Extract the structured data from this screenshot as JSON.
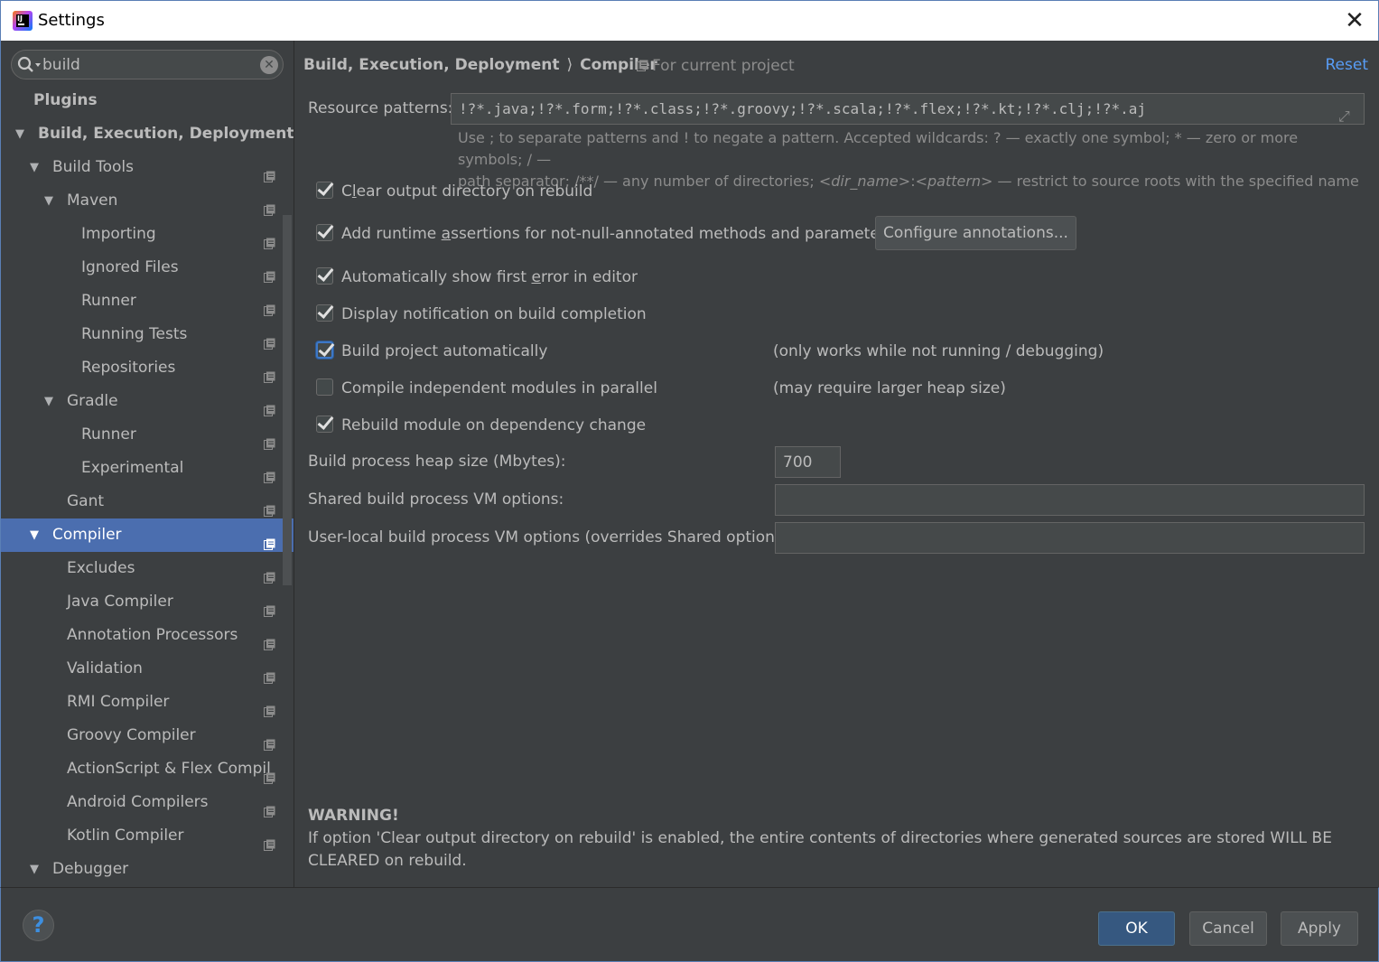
{
  "window": {
    "title": "Settings"
  },
  "search": {
    "value": "build"
  },
  "tree": [
    {
      "label": "Plugins",
      "level": 0,
      "arrow": "",
      "bold": true,
      "icon": false
    },
    {
      "label": "Build, Execution, Deployment",
      "level": 0,
      "arrow": "▼",
      "bold": true,
      "icon": false
    },
    {
      "label": "Build Tools",
      "level": 1,
      "arrow": "▼",
      "icon": true
    },
    {
      "label": "Maven",
      "level": 2,
      "arrow": "▼",
      "icon": true
    },
    {
      "label": "Importing",
      "level": 3,
      "arrow": "",
      "icon": true
    },
    {
      "label": "Ignored Files",
      "level": 3,
      "arrow": "",
      "icon": true
    },
    {
      "label": "Runner",
      "level": 3,
      "arrow": "",
      "icon": true
    },
    {
      "label": "Running Tests",
      "level": 3,
      "arrow": "",
      "icon": true
    },
    {
      "label": "Repositories",
      "level": 3,
      "arrow": "",
      "icon": true
    },
    {
      "label": "Gradle",
      "level": 2,
      "arrow": "▼",
      "icon": true
    },
    {
      "label": "Runner",
      "level": 3,
      "arrow": "",
      "icon": true
    },
    {
      "label": "Experimental",
      "level": 3,
      "arrow": "",
      "icon": true
    },
    {
      "label": "Gant",
      "level": 2,
      "arrow": "",
      "icon": true
    },
    {
      "label": "Compiler",
      "level": 1,
      "arrow": "▼",
      "icon": true,
      "selected": true
    },
    {
      "label": "Excludes",
      "level": 2,
      "arrow": "",
      "icon": true
    },
    {
      "label": "Java Compiler",
      "level": 2,
      "arrow": "",
      "icon": true
    },
    {
      "label": "Annotation Processors",
      "level": 2,
      "arrow": "",
      "icon": true
    },
    {
      "label": "Validation",
      "level": 2,
      "arrow": "",
      "icon": true
    },
    {
      "label": "RMI Compiler",
      "level": 2,
      "arrow": "",
      "icon": true
    },
    {
      "label": "Groovy Compiler",
      "level": 2,
      "arrow": "",
      "icon": true
    },
    {
      "label": "ActionScript & Flex Compil",
      "level": 2,
      "arrow": "",
      "icon": true
    },
    {
      "label": "Android Compilers",
      "level": 2,
      "arrow": "",
      "icon": true
    },
    {
      "label": "Kotlin Compiler",
      "level": 2,
      "arrow": "",
      "icon": true
    },
    {
      "label": "Debugger",
      "level": 1,
      "arrow": "▼",
      "icon": false
    }
  ],
  "header": {
    "crumb1": "Build, Execution, Deployment",
    "crumb2": "Compiler",
    "separator": "⟩",
    "scope": "For current project",
    "reset": "Reset"
  },
  "resource": {
    "label": "Resource patterns:",
    "value": "!?*.java;!?*.form;!?*.class;!?*.groovy;!?*.scala;!?*.flex;!?*.kt;!?*.clj;!?*.aj",
    "hint_line1": "Use ; to separate patterns and ! to negate a pattern. Accepted wildcards: ? — exactly one symbol; * — zero or more symbols; / —",
    "hint_line2a": "path separator; /**/ — any number of directories; ",
    "hint_dir": "<dir_name>",
    "hint_colon": ":",
    "hint_pattern": "<pattern>",
    "hint_line2b": " — restrict to source roots with the specified name"
  },
  "options": {
    "clear_output": {
      "pre": "C",
      "u": "l",
      "post": "ear output directory on rebuild"
    },
    "add_assertions": {
      "pre": "Add runtime ",
      "u": "a",
      "post": "ssertions for not-null-annotated methods and parameters"
    },
    "configure_annotations": "Configure annotations...",
    "show_first_error": {
      "pre": "Automatically show first ",
      "u": "e",
      "post": "rror in editor"
    },
    "display_notification": "Display notification on build completion",
    "build_auto": "Build project automatically",
    "build_auto_note": "(only works while not running / debugging)",
    "compile_parallel": "Compile independent modules in parallel",
    "compile_parallel_note": "(may require larger heap size)",
    "rebuild_on_change": "Rebuild module on dependency change"
  },
  "heap": {
    "label": "Build process heap size (Mbytes):",
    "value": "700"
  },
  "shared_vm": {
    "label": "Shared build process VM options:",
    "value": ""
  },
  "user_vm": {
    "label": "User-local build process VM options (overrides Shared options):",
    "value": ""
  },
  "warning": {
    "title": "WARNING!",
    "text": "If option 'Clear output directory on rebuild' is enabled, the entire contents of directories where generated sources are stored WILL BE CLEARED on rebuild."
  },
  "footer": {
    "help": "?",
    "ok": "OK",
    "cancel": "Cancel",
    "apply": "Apply"
  },
  "colors": {
    "accent": "#4b6eaf",
    "link": "#589df6",
    "background": "#3c3f41"
  }
}
